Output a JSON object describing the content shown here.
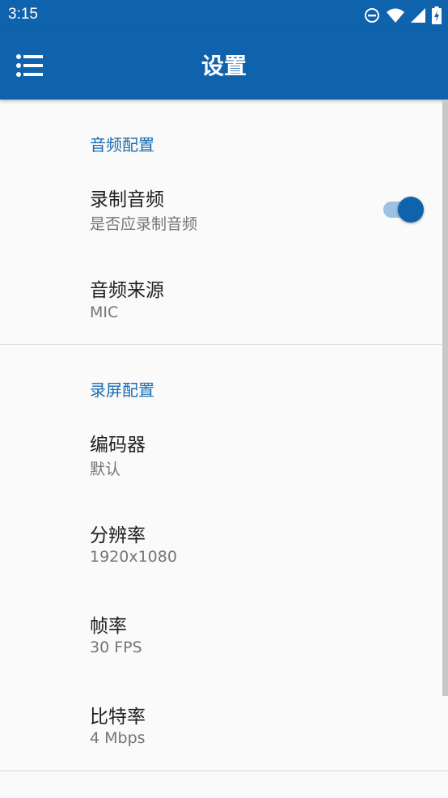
{
  "status_bar": {
    "time": "3:15",
    "icons": [
      "do-not-disturb-icon",
      "wifi-icon",
      "signal-icon",
      "battery-charging-icon"
    ]
  },
  "app_bar": {
    "menu_icon": "menu-list-icon",
    "title": "设置"
  },
  "sections": [
    {
      "header": "音频配置",
      "items": [
        {
          "title": "录制音频",
          "summary": "是否应录制音频",
          "switch_on": true
        },
        {
          "title": "音频来源",
          "summary": "MIC"
        }
      ]
    },
    {
      "header": "录屏配置",
      "items": [
        {
          "title": "编码器",
          "summary": "默认"
        },
        {
          "title": "分辨率",
          "summary": "1920x1080"
        },
        {
          "title": "帧率",
          "summary": "30 FPS"
        },
        {
          "title": "比特率",
          "summary": "4 Mbps"
        }
      ]
    }
  ],
  "colors": {
    "primary": "#0f63ad",
    "accent_text": "#1a6cb0",
    "switch_track": "#9cc1e1",
    "background": "#fafafa"
  }
}
